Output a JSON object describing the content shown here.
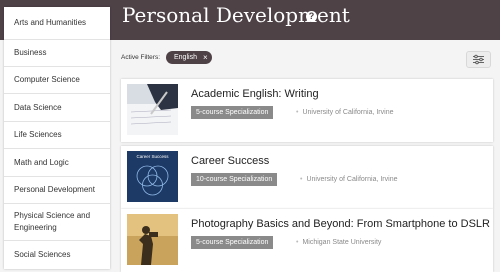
{
  "header": {
    "title": "Personal Development",
    "help_icon": "question-icon"
  },
  "sidebar": {
    "items": [
      "Arts and Humanities",
      "Business",
      "Computer Science",
      "Data Science",
      "Life Sciences",
      "Math and Logic",
      "Personal Development",
      "Physical Science and Engineering",
      "Social Sciences"
    ]
  },
  "filters": {
    "label": "Active Filters:",
    "chip": "English",
    "chip_close": "×",
    "settings_icon": "sliders-icon"
  },
  "courses": [
    {
      "title": "Academic English: Writing",
      "badge": "5-course Specialization",
      "provider": "University of California, Irvine"
    },
    {
      "title": "Career Success",
      "badge": "10-course Specialization",
      "provider": "University of California, Irvine",
      "thumb_text": "Career Success"
    },
    {
      "title": "Photography Basics and Beyond: From Smartphone to DSLR",
      "badge": "5-course Specialization",
      "provider": "Michigan State University"
    }
  ],
  "colors": {
    "header": "#4e4247",
    "badge": "#8a8a8a"
  }
}
